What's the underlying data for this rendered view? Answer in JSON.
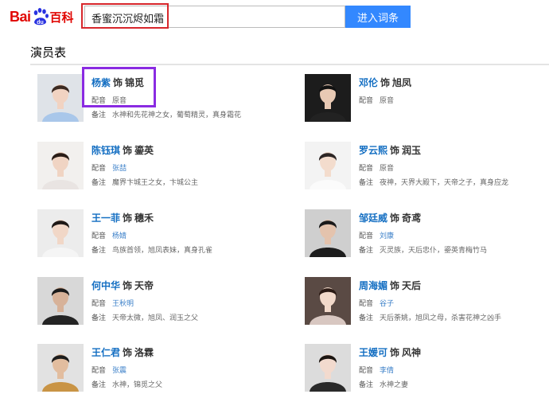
{
  "header": {
    "logo_bai": "Bai",
    "logo_du": "du",
    "logo_baike": "百科",
    "search_value": "香蜜沉沉烬如霜",
    "search_button": "进入词条"
  },
  "section": {
    "title": "演员表"
  },
  "as_word": "饰",
  "dub_label": "配音",
  "note_label": "备注",
  "cast": [
    {
      "actor": "杨紫",
      "role": "锦觅",
      "dub": "原音",
      "note": "水神和先花神之女，葡萄精灵，真身霜花"
    },
    {
      "actor": "邓伦",
      "role": "旭凤",
      "dub": "原音",
      "note": ""
    },
    {
      "actor": "陈钰琪",
      "role": "鎏英",
      "dub": "张喆",
      "note": "魔界卞城王之女，卞城公主"
    },
    {
      "actor": "罗云熙",
      "role": "润玉",
      "dub": "原音",
      "note": "夜神，天界大殿下，天帝之子，真身应龙"
    },
    {
      "actor": "王一菲",
      "role": "穗禾",
      "dub": "杨婧",
      "note": "鸟族首领，旭凤表妹，真身孔雀"
    },
    {
      "actor": "邹廷威",
      "role": "奇鸢",
      "dub": "刘康",
      "note": "灭灵族，天后忠仆，鎏英青梅竹马"
    },
    {
      "actor": "何中华",
      "role": "天帝",
      "dub": "王秋明",
      "note": "天帝太微，旭凤、润玉之父"
    },
    {
      "actor": "周海媚",
      "role": "天后",
      "dub": "谷子",
      "note": "天后荼姚，旭凤之母，杀害花神之凶手"
    },
    {
      "actor": "王仁君",
      "role": "洛霖",
      "dub": "张震",
      "note": "水神，锦觅之父"
    },
    {
      "actor": "王媛可",
      "role": "风神",
      "dub": "李倩",
      "note": "水神之妻"
    }
  ],
  "colors": {
    "brand_red": "#e10602",
    "link_blue": "#136ec2",
    "button_blue": "#3388ff",
    "annotation_red": "#d7262b",
    "annotation_purple": "#8a2be2"
  }
}
